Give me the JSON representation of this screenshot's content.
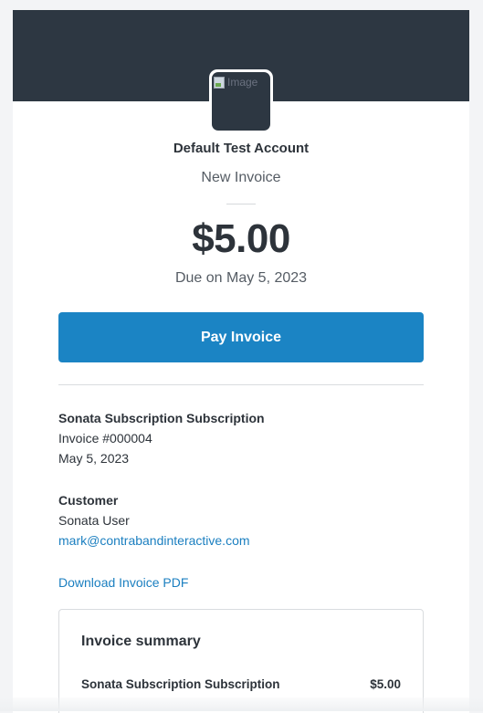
{
  "header": {
    "logo_alt": "Image",
    "account_name": "Default Test Account",
    "invoice_type": "New Invoice",
    "amount": "$5.00",
    "due_text": "Due on May 5, 2023"
  },
  "actions": {
    "pay_label": "Pay Invoice"
  },
  "subscription": {
    "title": "Sonata Subscription Subscription",
    "invoice_number": "Invoice #000004",
    "date": "May 5, 2023"
  },
  "customer": {
    "heading": "Customer",
    "name": "Sonata User",
    "email": "mark@contrabandinteractive.com"
  },
  "download": {
    "label": "Download Invoice PDF"
  },
  "summary": {
    "title": "Invoice summary",
    "items": [
      {
        "name": "Sonata Subscription Subscription",
        "amount": "$5.00"
      }
    ]
  },
  "colors": {
    "header_band": "#2d3742",
    "accent": "#1b84c4",
    "link": "#1b7fc0",
    "page_bg": "#f3f4f6"
  }
}
